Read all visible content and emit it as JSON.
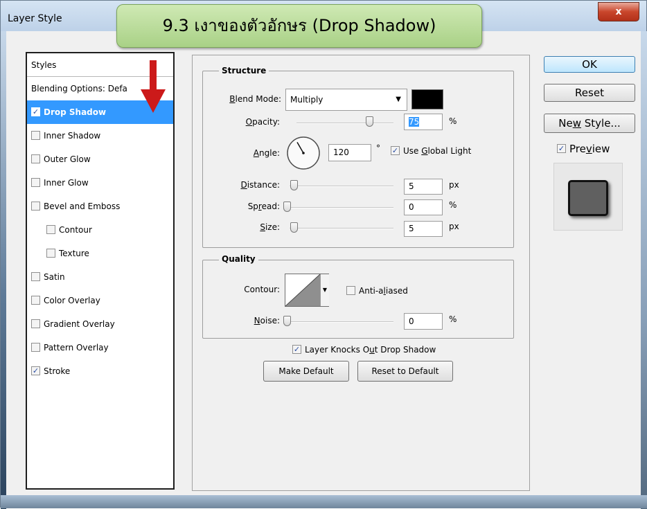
{
  "window": {
    "title": "Layer Style",
    "close_glyph": "x"
  },
  "callout": {
    "text": "9.3 เงาของตัวอักษร (Drop Shadow)"
  },
  "styles": {
    "header": "Styles",
    "items": [
      {
        "label": "Blending Options: Defa",
        "checkbox": false,
        "checked": false,
        "indent": false
      },
      {
        "label": "Drop Shadow",
        "checkbox": true,
        "checked": true,
        "indent": false,
        "selected": true
      },
      {
        "label": "Inner Shadow",
        "checkbox": true,
        "checked": false,
        "indent": false
      },
      {
        "label": "Outer Glow",
        "checkbox": true,
        "checked": false,
        "indent": false
      },
      {
        "label": "Inner Glow",
        "checkbox": true,
        "checked": false,
        "indent": false
      },
      {
        "label": "Bevel and Emboss",
        "checkbox": true,
        "checked": false,
        "indent": false
      },
      {
        "label": "Contour",
        "checkbox": true,
        "checked": false,
        "indent": true
      },
      {
        "label": "Texture",
        "checkbox": true,
        "checked": false,
        "indent": true
      },
      {
        "label": "Satin",
        "checkbox": true,
        "checked": false,
        "indent": false
      },
      {
        "label": "Color Overlay",
        "checkbox": true,
        "checked": false,
        "indent": false
      },
      {
        "label": "Gradient Overlay",
        "checkbox": true,
        "checked": false,
        "indent": false
      },
      {
        "label": "Pattern Overlay",
        "checkbox": true,
        "checked": false,
        "indent": false
      },
      {
        "label": "Stroke",
        "checkbox": true,
        "checked": true,
        "indent": false
      }
    ]
  },
  "structure": {
    "legend": "Structure",
    "blend_mode": {
      "label_pre": "",
      "label_ul": "B",
      "label_post": "lend Mode:",
      "value": "Multiply",
      "color": "#000000"
    },
    "opacity": {
      "label_pre": "",
      "label_ul": "O",
      "label_post": "pacity:",
      "value": "75",
      "unit": "%",
      "level": 0.75
    },
    "angle": {
      "label_pre": "",
      "label_ul": "A",
      "label_post": "ngle:",
      "value": "120",
      "unit": "°",
      "degrees": 120
    },
    "use_global_light": {
      "label_pre": "Use ",
      "label_ul": "G",
      "label_post": "lobal Light",
      "checked": true
    },
    "distance": {
      "label_pre": "",
      "label_ul": "D",
      "label_post": "istance:",
      "value": "5",
      "unit": "px",
      "level": 0.0
    },
    "spread": {
      "label_pre": "Sp",
      "label_ul": "r",
      "label_post": "ead:",
      "value": "0",
      "unit": "%",
      "level": 0.0
    },
    "size": {
      "label_pre": "",
      "label_ul": "S",
      "label_post": "ize:",
      "value": "5",
      "unit": "px",
      "level": 0.0
    }
  },
  "quality": {
    "legend": "Quality",
    "contour_label": "Contour:",
    "anti_aliased": {
      "label_pre": "Anti-a",
      "label_ul": "l",
      "label_post": "iased",
      "checked": false
    },
    "noise": {
      "label_pre": "",
      "label_ul": "N",
      "label_post": "oise:",
      "value": "0",
      "unit": "%",
      "level": 0.0
    }
  },
  "layer_knocks_out": {
    "label_pre": "Layer Knocks O",
    "label_ul": "u",
    "label_post": "t Drop Shadow",
    "checked": true
  },
  "buttons": {
    "make_default": "Make Default",
    "reset_to_default": "Reset to Default",
    "ok": "OK",
    "reset": "Reset",
    "new_style_pre": "Ne",
    "new_style_ul": "w",
    "new_style_post": " Style...",
    "preview_pre": "Pre",
    "preview_ul": "v",
    "preview_post": "iew",
    "preview_checked": true
  },
  "colors": {
    "selection": "#3399ff",
    "callout": "#a9d186",
    "arrow": "#cc1a1a"
  }
}
